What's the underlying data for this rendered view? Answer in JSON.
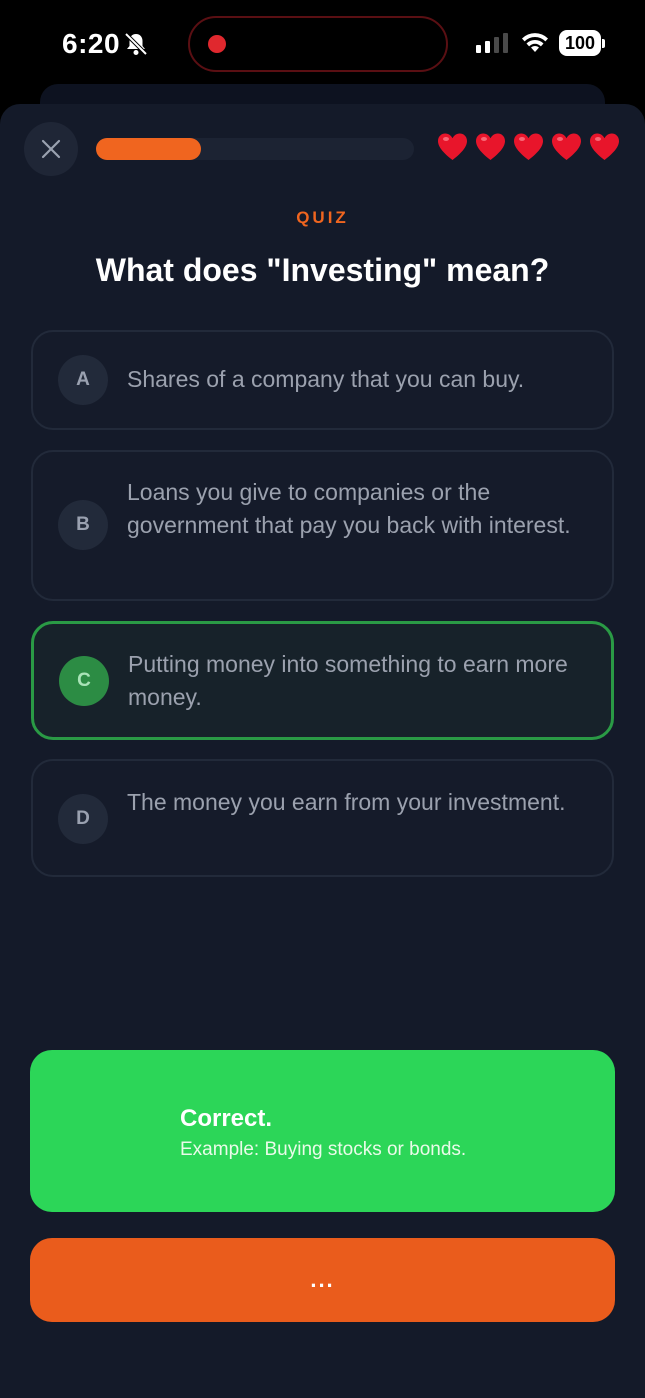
{
  "status_bar": {
    "time": "6:20",
    "battery": "100",
    "icons": [
      "bell-slash-icon",
      "record-dot-icon",
      "cellular-signal-icon",
      "wifi-icon",
      "battery-icon"
    ]
  },
  "header": {
    "close_icon": "close-icon",
    "progress": 0.33,
    "lives": 5,
    "heart_icon": "heart-icon",
    "colors": {
      "accent": "#f0651f",
      "heart": "#e8152b"
    }
  },
  "quiz": {
    "kicker": "QUIZ",
    "question": "What does \"Investing\" mean?",
    "selected": "C",
    "options": [
      {
        "letter": "A",
        "text": "Shares of a company that you can buy."
      },
      {
        "letter": "B",
        "text": "Loans you give to companies or the government that pay you back with interest."
      },
      {
        "letter": "C",
        "text": "Putting money into something to earn more money."
      },
      {
        "letter": "D",
        "text": "The money you earn from your investment."
      }
    ]
  },
  "feedback": {
    "title": "Correct.",
    "subtitle": "Example: Buying stocks or bonds.",
    "color": "#2cd658"
  },
  "footer": {
    "button_label": "...",
    "button_color": "#ea5c1c"
  }
}
